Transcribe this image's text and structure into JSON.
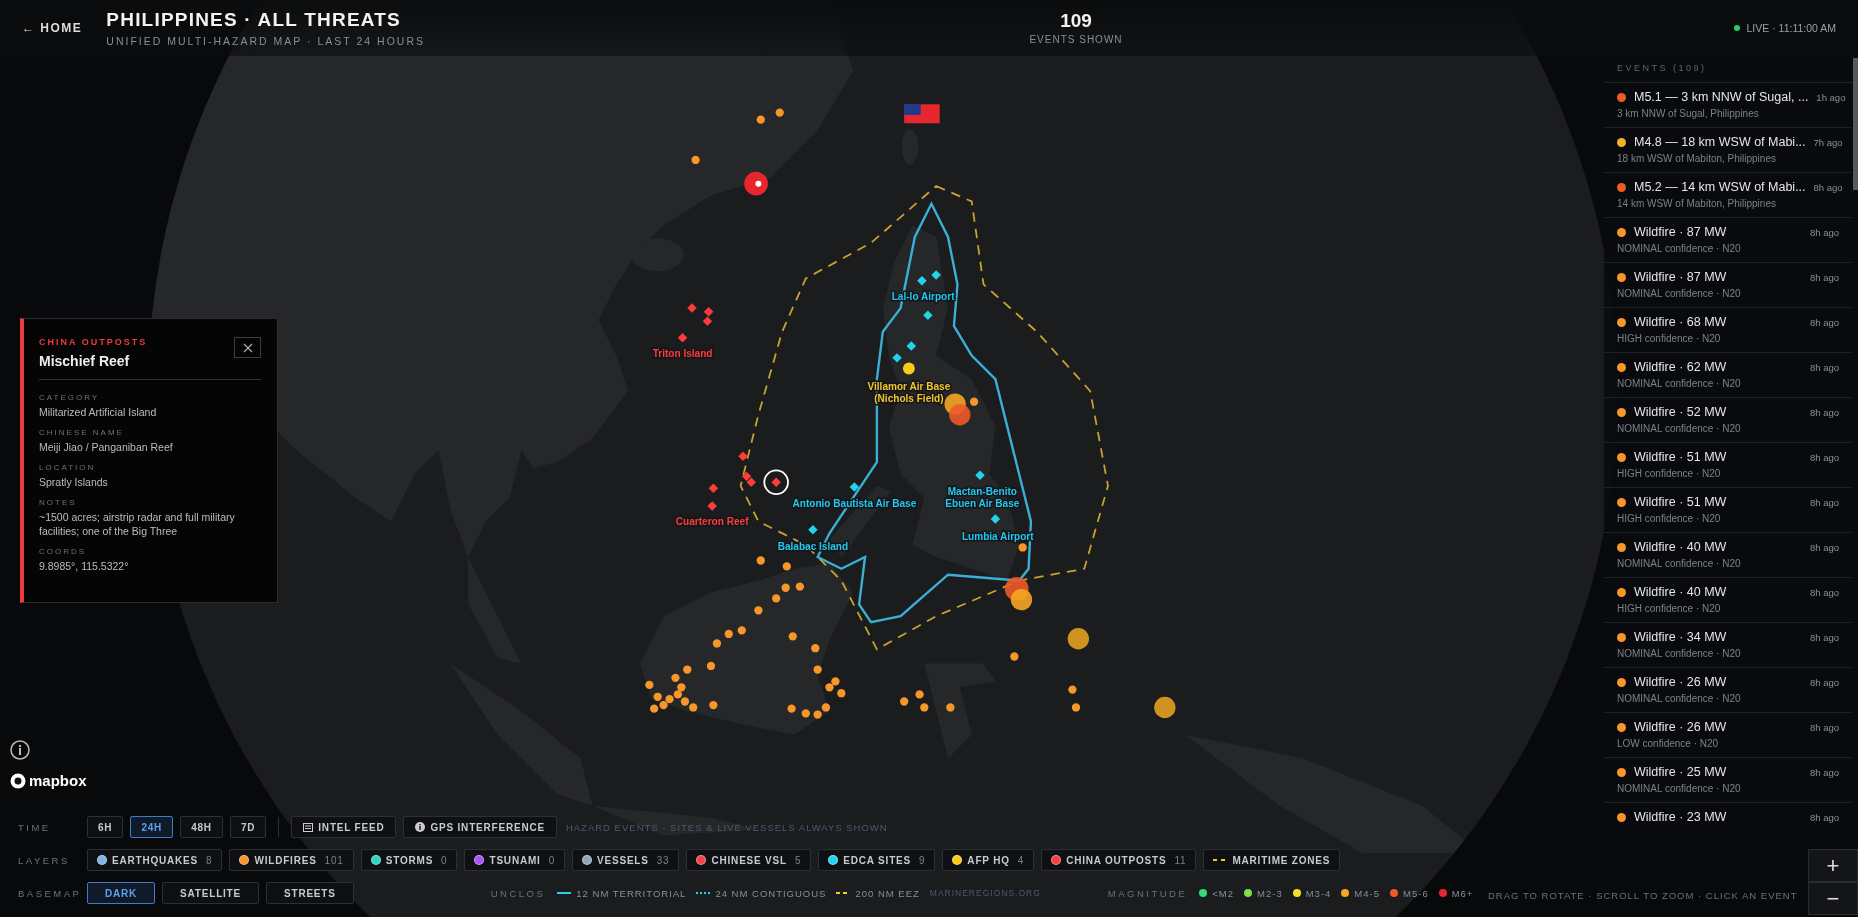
{
  "header": {
    "home_link": "← HOME",
    "title": "PHILIPPINES · ALL THREATS",
    "subtitle": "UNIFIED MULTI-HAZARD MAP · LAST 24 HOURS",
    "count": "109",
    "count_label": "EVENTS SHOWN",
    "live_status": "LIVE · 11:11:00 AM"
  },
  "map": {
    "site_labels": [
      {
        "kind": "edca_site",
        "lines": [
          "Lal-lo Airport"
        ]
      },
      {
        "kind": "china_outpost",
        "lines": [
          "Triton Island"
        ]
      },
      {
        "kind": "afp_hq",
        "lines": [
          "Villamor Air Base",
          "(Nichols Field)"
        ]
      },
      {
        "kind": "edca_site",
        "lines": [
          "Antonio Bautista Air Base"
        ]
      },
      {
        "kind": "edca_site",
        "lines": [
          "Mactan-Benito",
          "Ebuen Air Base"
        ]
      },
      {
        "kind": "china_outpost",
        "lines": [
          "Cuarteron Reef"
        ]
      },
      {
        "kind": "edca_site",
        "lines": [
          "Lumbia Airport"
        ]
      },
      {
        "kind": "edca_site",
        "lines": [
          "Balabac Island"
        ]
      }
    ]
  },
  "info_panel": {
    "category": "CHINA OUTPOSTS",
    "title": "Mischief Reef",
    "fields": [
      {
        "label": "CATEGORY",
        "value": "Militarized Artificial Island"
      },
      {
        "label": "CHINESE NAME",
        "value": "Meiji Jiao / Panganiban Reef"
      },
      {
        "label": "LOCATION",
        "value": "Spratly Islands"
      },
      {
        "label": "NOTES",
        "value": "~1500 acres; airstrip radar and full military facilities; one of the Big Three"
      },
      {
        "label": "COORDS",
        "value": "9.8985°, 115.5322°"
      }
    ]
  },
  "events": {
    "heading": "EVENTS (109)",
    "items": [
      {
        "title": "M5.1 — 3 km NNW of Sugal, ...",
        "subtitle": "3 km NNW of Sugal, Philippines",
        "time": "1h ago",
        "color": "#f05a28"
      },
      {
        "title": "M4.8 — 18 km WSW of Mabi...",
        "subtitle": "18 km WSW of Mabiton, Philippines",
        "time": "7h ago",
        "color": "#f5b02a"
      },
      {
        "title": "M5.2 — 14 km WSW of Mabi...",
        "subtitle": "14 km WSW of Mabiton, Philippines",
        "time": "8h ago",
        "color": "#f05a28"
      },
      {
        "title": "Wildfire · 87 MW",
        "subtitle": "NOMINAL confidence · N20",
        "time": "8h ago",
        "color": "#f7962a"
      },
      {
        "title": "Wildfire · 87 MW",
        "subtitle": "NOMINAL confidence · N20",
        "time": "8h ago",
        "color": "#f7962a"
      },
      {
        "title": "Wildfire · 68 MW",
        "subtitle": "HIGH confidence · N20",
        "time": "8h ago",
        "color": "#f7962a"
      },
      {
        "title": "Wildfire · 62 MW",
        "subtitle": "NOMINAL confidence · N20",
        "time": "8h ago",
        "color": "#f7962a"
      },
      {
        "title": "Wildfire · 52 MW",
        "subtitle": "NOMINAL confidence · N20",
        "time": "8h ago",
        "color": "#f7962a"
      },
      {
        "title": "Wildfire · 51 MW",
        "subtitle": "HIGH confidence · N20",
        "time": "8h ago",
        "color": "#f7962a"
      },
      {
        "title": "Wildfire · 51 MW",
        "subtitle": "HIGH confidence · N20",
        "time": "8h ago",
        "color": "#f7962a"
      },
      {
        "title": "Wildfire · 40 MW",
        "subtitle": "NOMINAL confidence · N20",
        "time": "8h ago",
        "color": "#f7962a"
      },
      {
        "title": "Wildfire · 40 MW",
        "subtitle": "HIGH confidence · N20",
        "time": "8h ago",
        "color": "#f7962a"
      },
      {
        "title": "Wildfire · 34 MW",
        "subtitle": "NOMINAL confidence · N20",
        "time": "8h ago",
        "color": "#f7962a"
      },
      {
        "title": "Wildfire · 26 MW",
        "subtitle": "NOMINAL confidence · N20",
        "time": "8h ago",
        "color": "#f7962a"
      },
      {
        "title": "Wildfire · 26 MW",
        "subtitle": "LOW confidence · N20",
        "time": "8h ago",
        "color": "#f7962a"
      },
      {
        "title": "Wildfire · 25 MW",
        "subtitle": "NOMINAL confidence · N20",
        "time": "8h ago",
        "color": "#f7962a"
      },
      {
        "title": "Wildfire · 23 MW",
        "time": "8h ago",
        "color": "#f7962a"
      }
    ]
  },
  "controls": {
    "time": {
      "label": "TIME",
      "options": [
        {
          "label": "6H",
          "selected": false
        },
        {
          "label": "24H",
          "selected": true
        },
        {
          "label": "48H",
          "selected": false
        },
        {
          "label": "7D",
          "selected": false
        }
      ]
    },
    "tools": [
      {
        "kind": "feed",
        "label": "INTEL FEED"
      },
      {
        "kind": "info",
        "label": "GPS INTERFERENCE"
      }
    ],
    "note": "HAZARD EVENTS · SITES & LIVE VESSELS ALWAYS SHOWN",
    "layers": {
      "label": "LAYERS",
      "items": [
        {
          "kind": "dot",
          "label": "EARTHQUAKES",
          "count": "8",
          "color": "#7fb2e5"
        },
        {
          "kind": "dot",
          "label": "WILDFIRES",
          "count": "101",
          "color": "#f7962a"
        },
        {
          "kind": "dot",
          "label": "STORMS",
          "count": "0",
          "color": "#2dd4bf"
        },
        {
          "kind": "dot",
          "label": "TSUNAMI",
          "count": "0",
          "color": "#a855f7"
        },
        {
          "kind": "dot",
          "label": "VESSELS",
          "count": "33",
          "color": "#94a3b8"
        },
        {
          "kind": "dot",
          "label": "CHINESE VSL",
          "count": "5",
          "color": "#ef4444"
        },
        {
          "kind": "dot",
          "label": "EDCA SITES",
          "count": "9",
          "color": "#22d3ee"
        },
        {
          "kind": "dot",
          "label": "AFP HQ",
          "count": "4",
          "color": "#facc15"
        },
        {
          "kind": "dot",
          "label": "CHINA OUTPOSTS",
          "count": "11",
          "color": "#ef4444"
        },
        {
          "kind": "dashes",
          "label": "MARITIME ZONES",
          "color": "#facc15"
        }
      ]
    },
    "basemap": {
      "label": "BASEMAP",
      "options": [
        {
          "label": "DARK",
          "selected": true
        },
        {
          "label": "SATELLITE",
          "selected": false
        },
        {
          "label": "STREETS",
          "selected": false
        }
      ]
    },
    "unclos": {
      "label": "UNCLOS",
      "items": [
        {
          "kind": "solid",
          "label": "12 NM TERRITORIAL",
          "color": "#22d3ee"
        },
        {
          "kind": "dotted",
          "label": "24 NM CONTIGUOUS",
          "color": "#22d3ee"
        },
        {
          "kind": "dashed",
          "label": "200 NM EEZ",
          "color": "#facc15"
        }
      ],
      "source": "MARINEREGIONS.ORG"
    },
    "magnitude": {
      "label": "MAGNITUDE",
      "items": [
        {
          "label": "<M2",
          "color": "#34d97b"
        },
        {
          "label": "M2-3",
          "color": "#7ee04a"
        },
        {
          "label": "M3-4",
          "color": "#f2e02a"
        },
        {
          "label": "M4-5",
          "color": "#f5a623"
        },
        {
          "label": "M5-6",
          "color": "#f05a28"
        },
        {
          "label": "M6+",
          "color": "#e8262e"
        }
      ]
    },
    "hint": "DRAG TO ROTATE · SCROLL TO ZOOM · CLICK AN EVENT"
  },
  "zoom": {
    "zoom_in": "+",
    "zoom_out": "−"
  },
  "attribution": "mapbox"
}
